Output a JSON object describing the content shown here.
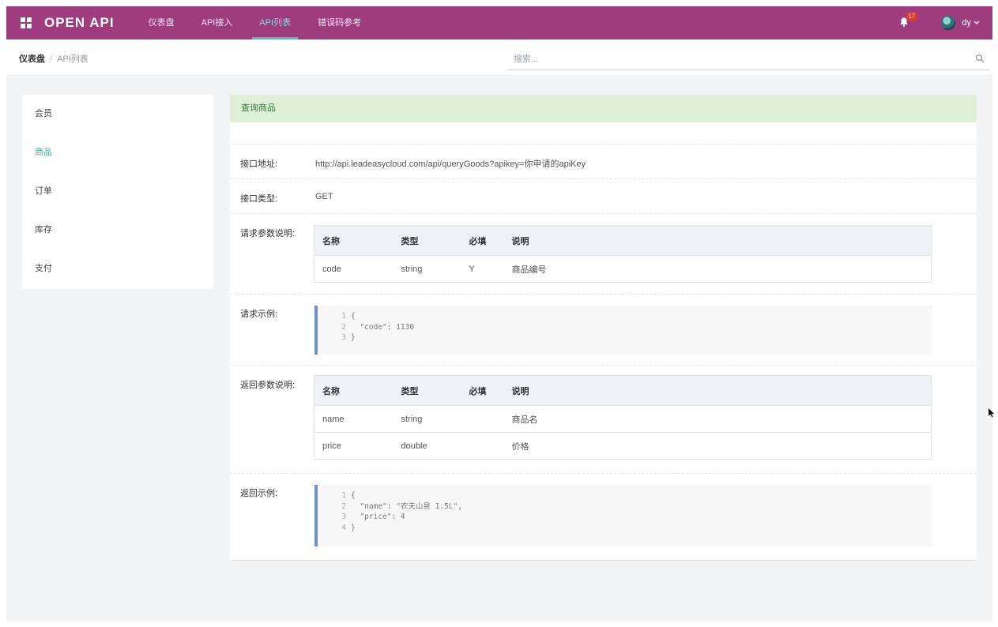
{
  "header": {
    "brand": "OPEN API",
    "nav": [
      {
        "label": "仪表盘",
        "active": false
      },
      {
        "label": "API接入",
        "active": false
      },
      {
        "label": "API列表",
        "active": true
      },
      {
        "label": "错误码参考",
        "active": false
      }
    ],
    "notification_count": "17",
    "user_name": "dy"
  },
  "breadcrumb": {
    "home": "仪表盘",
    "separator": "/",
    "current": "API列表"
  },
  "search": {
    "placeholder": "搜索..."
  },
  "sidebar": {
    "items": [
      {
        "label": "会员",
        "active": false
      },
      {
        "label": "商品",
        "active": true
      },
      {
        "label": "订单",
        "active": false
      },
      {
        "label": "库存",
        "active": false
      },
      {
        "label": "支付",
        "active": false
      }
    ]
  },
  "panel": {
    "title": "查询商品",
    "url_label": "接口地址:",
    "url_value": "http://api.leadeasycloud.com/api/queryGoods?apikey=你申请的apiKey",
    "method_label": "接口类型:",
    "method_value": "GET",
    "request_params_label": "请求参数说明:",
    "request_params": {
      "headers": [
        "名称",
        "类型",
        "必填",
        "说明"
      ],
      "rows": [
        [
          "code",
          "string",
          "Y",
          "商品编号"
        ]
      ]
    },
    "request_example_label": "请求示例:",
    "request_example": [
      {
        "n": "1",
        "text": "{"
      },
      {
        "n": "2",
        "text": "  \"code\": 1130"
      },
      {
        "n": "3",
        "text": "}"
      }
    ],
    "response_params_label": "返回参数说明:",
    "response_params": {
      "headers": [
        "名称",
        "类型",
        "必填",
        "说明"
      ],
      "rows": [
        [
          "name",
          "string",
          "",
          "商品名"
        ],
        [
          "price",
          "double",
          "",
          "价格"
        ]
      ]
    },
    "response_example_label": "返回示例:",
    "response_example": [
      {
        "n": "1",
        "text": "{"
      },
      {
        "n": "2",
        "text": "  \"name\": \"农夫山泉 1.5L\","
      },
      {
        "n": "3",
        "text": "  \"price\": 4"
      },
      {
        "n": "4",
        "text": "}"
      }
    ]
  },
  "colors": {
    "topbar": "#9f3b7f",
    "accent": "#49c4ad",
    "panel_head": "#dff0d8",
    "code_border": "#6b8fcf"
  }
}
